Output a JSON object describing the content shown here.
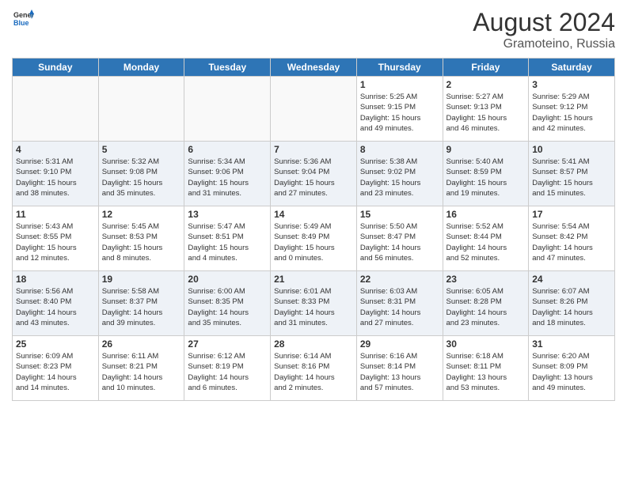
{
  "header": {
    "logo_general": "General",
    "logo_blue": "Blue",
    "month_year": "August 2024",
    "location": "Gramoteino, Russia"
  },
  "days_of_week": [
    "Sunday",
    "Monday",
    "Tuesday",
    "Wednesday",
    "Thursday",
    "Friday",
    "Saturday"
  ],
  "weeks": [
    [
      {
        "day": "",
        "info": ""
      },
      {
        "day": "",
        "info": ""
      },
      {
        "day": "",
        "info": ""
      },
      {
        "day": "",
        "info": ""
      },
      {
        "day": "1",
        "info": "Sunrise: 5:25 AM\nSunset: 9:15 PM\nDaylight: 15 hours\nand 49 minutes."
      },
      {
        "day": "2",
        "info": "Sunrise: 5:27 AM\nSunset: 9:13 PM\nDaylight: 15 hours\nand 46 minutes."
      },
      {
        "day": "3",
        "info": "Sunrise: 5:29 AM\nSunset: 9:12 PM\nDaylight: 15 hours\nand 42 minutes."
      }
    ],
    [
      {
        "day": "4",
        "info": "Sunrise: 5:31 AM\nSunset: 9:10 PM\nDaylight: 15 hours\nand 38 minutes."
      },
      {
        "day": "5",
        "info": "Sunrise: 5:32 AM\nSunset: 9:08 PM\nDaylight: 15 hours\nand 35 minutes."
      },
      {
        "day": "6",
        "info": "Sunrise: 5:34 AM\nSunset: 9:06 PM\nDaylight: 15 hours\nand 31 minutes."
      },
      {
        "day": "7",
        "info": "Sunrise: 5:36 AM\nSunset: 9:04 PM\nDaylight: 15 hours\nand 27 minutes."
      },
      {
        "day": "8",
        "info": "Sunrise: 5:38 AM\nSunset: 9:02 PM\nDaylight: 15 hours\nand 23 minutes."
      },
      {
        "day": "9",
        "info": "Sunrise: 5:40 AM\nSunset: 8:59 PM\nDaylight: 15 hours\nand 19 minutes."
      },
      {
        "day": "10",
        "info": "Sunrise: 5:41 AM\nSunset: 8:57 PM\nDaylight: 15 hours\nand 15 minutes."
      }
    ],
    [
      {
        "day": "11",
        "info": "Sunrise: 5:43 AM\nSunset: 8:55 PM\nDaylight: 15 hours\nand 12 minutes."
      },
      {
        "day": "12",
        "info": "Sunrise: 5:45 AM\nSunset: 8:53 PM\nDaylight: 15 hours\nand 8 minutes."
      },
      {
        "day": "13",
        "info": "Sunrise: 5:47 AM\nSunset: 8:51 PM\nDaylight: 15 hours\nand 4 minutes."
      },
      {
        "day": "14",
        "info": "Sunrise: 5:49 AM\nSunset: 8:49 PM\nDaylight: 15 hours\nand 0 minutes."
      },
      {
        "day": "15",
        "info": "Sunrise: 5:50 AM\nSunset: 8:47 PM\nDaylight: 14 hours\nand 56 minutes."
      },
      {
        "day": "16",
        "info": "Sunrise: 5:52 AM\nSunset: 8:44 PM\nDaylight: 14 hours\nand 52 minutes."
      },
      {
        "day": "17",
        "info": "Sunrise: 5:54 AM\nSunset: 8:42 PM\nDaylight: 14 hours\nand 47 minutes."
      }
    ],
    [
      {
        "day": "18",
        "info": "Sunrise: 5:56 AM\nSunset: 8:40 PM\nDaylight: 14 hours\nand 43 minutes."
      },
      {
        "day": "19",
        "info": "Sunrise: 5:58 AM\nSunset: 8:37 PM\nDaylight: 14 hours\nand 39 minutes."
      },
      {
        "day": "20",
        "info": "Sunrise: 6:00 AM\nSunset: 8:35 PM\nDaylight: 14 hours\nand 35 minutes."
      },
      {
        "day": "21",
        "info": "Sunrise: 6:01 AM\nSunset: 8:33 PM\nDaylight: 14 hours\nand 31 minutes."
      },
      {
        "day": "22",
        "info": "Sunrise: 6:03 AM\nSunset: 8:31 PM\nDaylight: 14 hours\nand 27 minutes."
      },
      {
        "day": "23",
        "info": "Sunrise: 6:05 AM\nSunset: 8:28 PM\nDaylight: 14 hours\nand 23 minutes."
      },
      {
        "day": "24",
        "info": "Sunrise: 6:07 AM\nSunset: 8:26 PM\nDaylight: 14 hours\nand 18 minutes."
      }
    ],
    [
      {
        "day": "25",
        "info": "Sunrise: 6:09 AM\nSunset: 8:23 PM\nDaylight: 14 hours\nand 14 minutes."
      },
      {
        "day": "26",
        "info": "Sunrise: 6:11 AM\nSunset: 8:21 PM\nDaylight: 14 hours\nand 10 minutes."
      },
      {
        "day": "27",
        "info": "Sunrise: 6:12 AM\nSunset: 8:19 PM\nDaylight: 14 hours\nand 6 minutes."
      },
      {
        "day": "28",
        "info": "Sunrise: 6:14 AM\nSunset: 8:16 PM\nDaylight: 14 hours\nand 2 minutes."
      },
      {
        "day": "29",
        "info": "Sunrise: 6:16 AM\nSunset: 8:14 PM\nDaylight: 13 hours\nand 57 minutes."
      },
      {
        "day": "30",
        "info": "Sunrise: 6:18 AM\nSunset: 8:11 PM\nDaylight: 13 hours\nand 53 minutes."
      },
      {
        "day": "31",
        "info": "Sunrise: 6:20 AM\nSunset: 8:09 PM\nDaylight: 13 hours\nand 49 minutes."
      }
    ]
  ]
}
